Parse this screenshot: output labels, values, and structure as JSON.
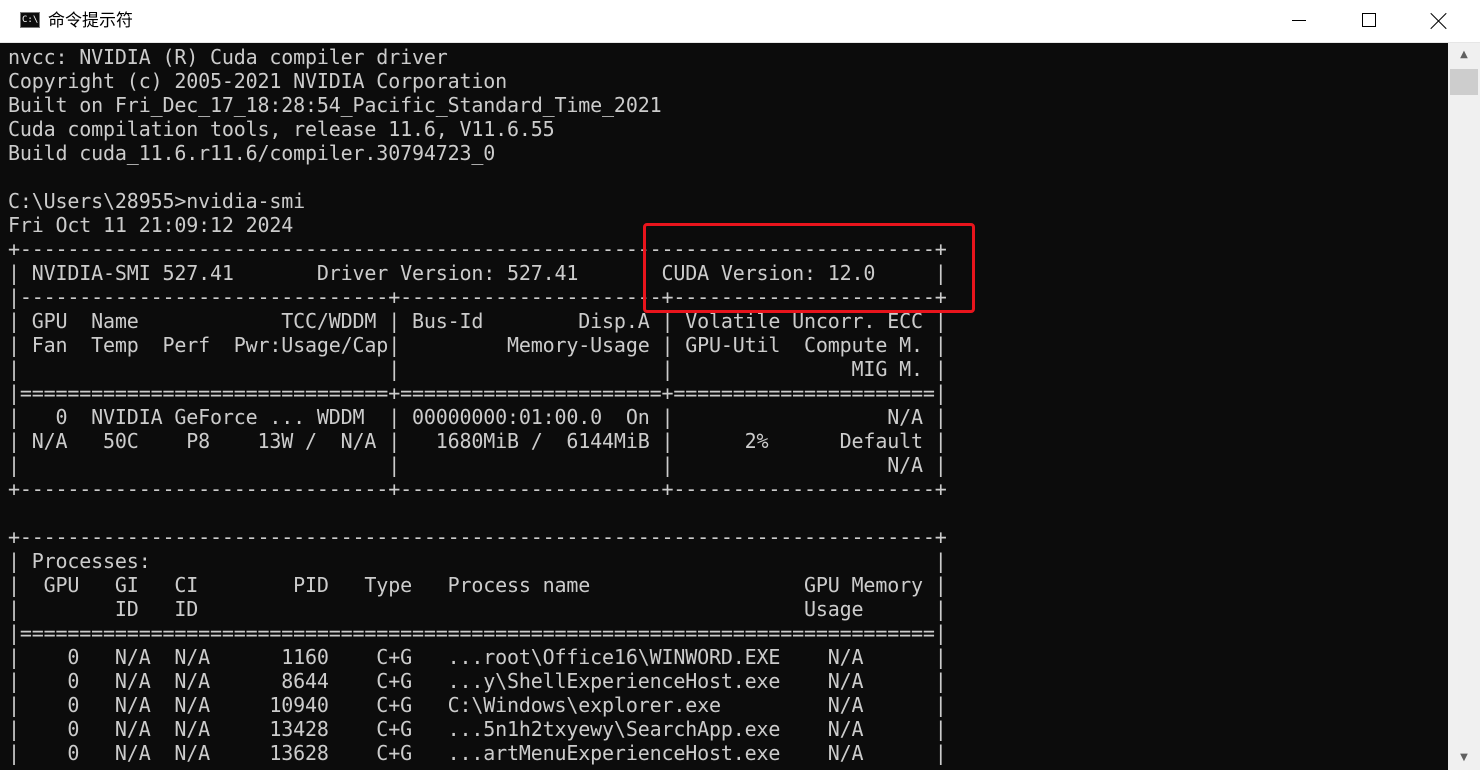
{
  "window": {
    "title": "命令提示符",
    "icon_label": "C:\\",
    "icon": "cmd-console-icon",
    "minimize_icon": "minimize-icon",
    "maximize_icon": "maximize-icon",
    "close_icon": "close-icon"
  },
  "colors": {
    "console_background": "#0c0c0c",
    "console_text": "#cccccc",
    "highlight_border": "#e8141c",
    "titlebar_background": "#ffffff"
  },
  "console": {
    "text": "nvcc: NVIDIA (R) Cuda compiler driver\nCopyright (c) 2005-2021 NVIDIA Corporation\nBuilt on Fri_Dec_17_18:28:54_Pacific_Standard_Time_2021\nCuda compilation tools, release 11.6, V11.6.55\nBuild cuda_11.6.r11.6/compiler.30794723_0\n\nC:\\Users\\28955>nvidia-smi\nFri Oct 11 21:09:12 2024\n+-----------------------------------------------------------------------------+\n| NVIDIA-SMI 527.41       Driver Version: 527.41       CUDA Version: 12.0     |\n|-------------------------------+----------------------+----------------------+\n| GPU  Name            TCC/WDDM | Bus-Id        Disp.A | Volatile Uncorr. ECC |\n| Fan  Temp  Perf  Pwr:Usage/Cap|         Memory-Usage | GPU-Util  Compute M. |\n|                               |                      |               MIG M. |\n|===============================+======================+======================|\n|   0  NVIDIA GeForce ... WDDM  | 00000000:01:00.0  On |                  N/A |\n| N/A   50C    P8    13W /  N/A |   1680MiB /  6144MiB |      2%      Default |\n|                               |                      |                  N/A |\n+-------------------------------+----------------------+----------------------+\n\n+-----------------------------------------------------------------------------+\n| Processes:                                                                  |\n|  GPU   GI   CI        PID   Type   Process name                  GPU Memory |\n|        ID   ID                                                   Usage      |\n|=============================================================================|\n|    0   N/A  N/A      1160    C+G   ...root\\Office16\\WINWORD.EXE    N/A      |\n|    0   N/A  N/A      8644    C+G   ...y\\ShellExperienceHost.exe    N/A      |\n|    0   N/A  N/A     10940    C+G   C:\\Windows\\explorer.exe         N/A      |\n|    0   N/A  N/A     13428    C+G   ...5n1h2txyewy\\SearchApp.exe    N/A      |\n|    0   N/A  N/A     13628    C+G   ...artMenuExperienceHost.exe    N/A      |"
  },
  "scrollbar": {
    "up_arrow": "▲",
    "down_arrow": "▼",
    "up_icon": "scroll-up-arrow-icon",
    "down_icon": "scroll-down-arrow-icon"
  }
}
